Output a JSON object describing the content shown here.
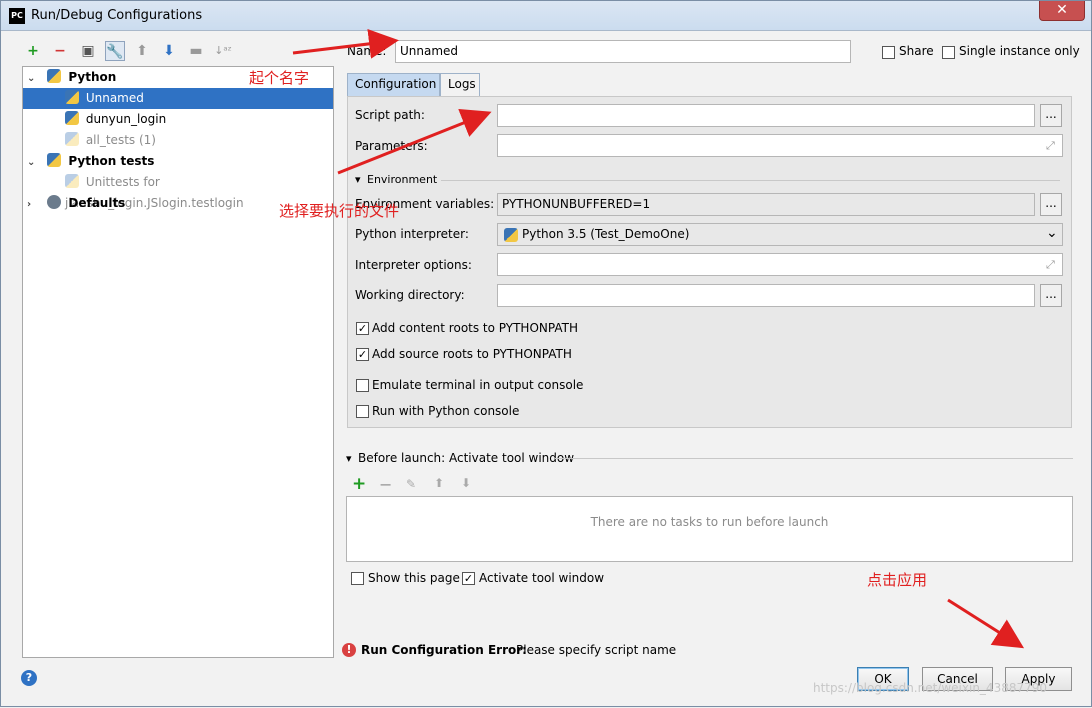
{
  "window": {
    "title": "Run/Debug Configurations",
    "app_icon_text": "PC",
    "close_symbol": "✕"
  },
  "toolbar": {
    "icons": [
      "add-icon",
      "remove-icon",
      "copy-icon",
      "wrench-icon",
      "move-up-icon",
      "move-down-icon",
      "folder-icon",
      "sort-icon"
    ]
  },
  "tree": {
    "items": [
      {
        "label": "Python"
      },
      {
        "label": "Unnamed"
      },
      {
        "label": "dunyun_login"
      },
      {
        "label": "all_tests (1)"
      },
      {
        "label": "Python tests"
      },
      {
        "label": "Unittests for jianshu_login.JSlogin.testlogin"
      },
      {
        "label": "Defaults"
      }
    ]
  },
  "top": {
    "name_label": "Name:",
    "name_value": "Unnamed",
    "share_label": "Share",
    "single_instance_label": "Single instance only"
  },
  "tabs": [
    {
      "label": "Configuration"
    },
    {
      "label": "Logs"
    }
  ],
  "config": {
    "script_path_label": "Script path:",
    "script_path_value": "",
    "parameters_label": "Parameters:",
    "parameters_value": "",
    "environment_header": "Environment",
    "env_vars_label": "Environment variables:",
    "env_vars_value": "PYTHONUNBUFFERED=1",
    "interpreter_label": "Python interpreter:",
    "interpreter_value": "Python 3.5 (Test_DemoOne)",
    "interpreter_options_label": "Interpreter options:",
    "working_dir_label": "Working directory:",
    "browse_label": "...",
    "checks": [
      {
        "label": "Add content roots to PYTHONPATH",
        "checked": true
      },
      {
        "label": "Add source roots to PYTHONPATH",
        "checked": true
      },
      {
        "label": "Emulate terminal in output console",
        "checked": false
      },
      {
        "label": "Run with Python console",
        "checked": false
      }
    ]
  },
  "before_launch": {
    "header": "Before launch: Activate tool window",
    "empty_message": "There are no tasks to run before launch",
    "show_page_label": "Show this page",
    "activate_label": "Activate tool window"
  },
  "error": {
    "title": "Run Configuration Error:",
    "message": "Please specify script name"
  },
  "buttons": {
    "ok": "OK",
    "cancel": "Cancel",
    "apply": "Apply",
    "help": "?"
  },
  "annotations": {
    "name_hint": "起个名字",
    "file_hint": "选择要执行的文件",
    "apply_hint": "点击应用"
  },
  "watermark": "https://blog.csdn.net/weixin_43887790"
}
